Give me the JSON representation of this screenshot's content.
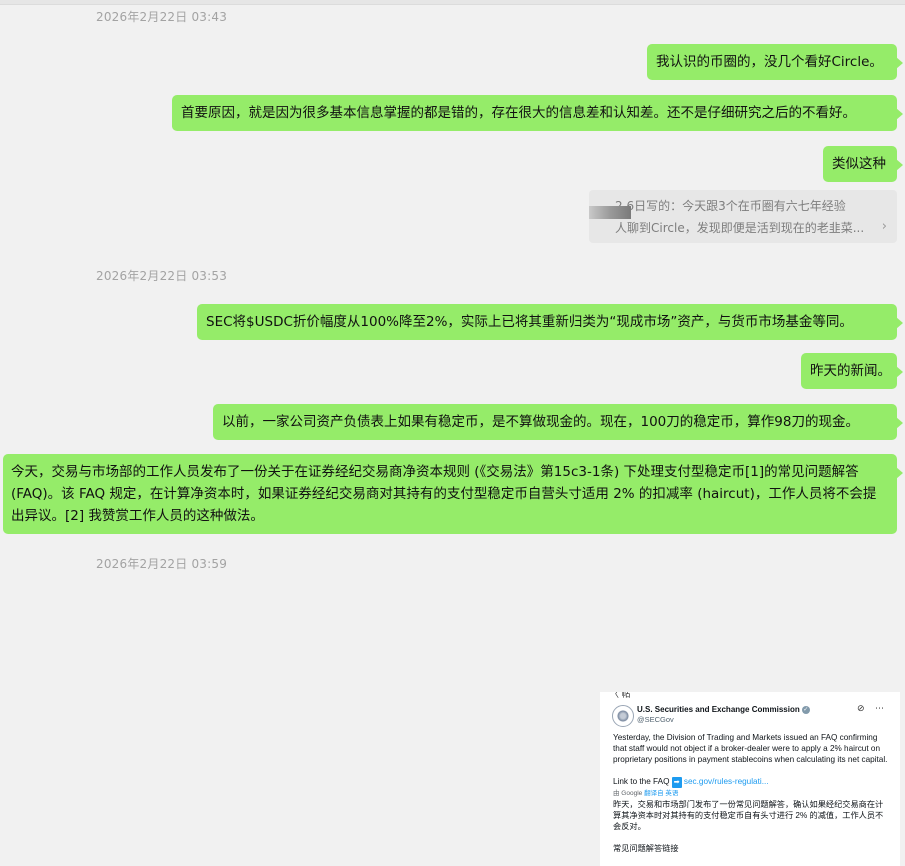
{
  "timestamps": [
    "2026年2月22日 03:43",
    "2026年2月22日 03:53",
    "2026年2月22日 03:59"
  ],
  "messages": {
    "m1": "我认识的币圈的，没几个看好Circle。",
    "m2": "首要原因，就是因为很多基本信息掌握的都是错的，存在很大的信息差和认知差。还不是仔细研究之后的不看好。",
    "m3": "类似这种",
    "m4": "SEC将$USDC折价幅度从100%降至2%，实际上已将其重新归类为“现成市场”资产，与货币市场基金等同。",
    "m5": "昨天的新闻。",
    "m6": "以前，一家公司资产负债表上如果有稳定币，是不算做现金的。现在，100刀的稳定币，算作98刀的现金。",
    "m7": "今天，交易与市场部的工作人员发布了一份关于在证券经纪交易商净资本规则 (《交易法》第15c3-1条) 下处理支付型稳定币[1]的常见问题解答 (FAQ)。该 FAQ 规定，在计算净资本时，如果证券经纪交易商对其持有的支付型稳定币自营头寸适用 2% 的扣减率 (haircut)，工作人员将不会提出异议。[2] 我赞赏工作人员的这种做法。"
  },
  "quote": {
    "line1": "2.6日写的：今天跟3个在币圈有六七年经验",
    "line2": "人聊到Circle，发现即便是活到现在的老韭菜...",
    "chevron": "›"
  },
  "screenshot": {
    "cut_text": "〈 帖",
    "account_name": "U.S. Securities and Exchange Commission",
    "handle": "@SECGov",
    "icons": "⊘ ⋯",
    "post_text": "Yesterday, the Division of Trading and Markets issued an FAQ confirming that staff would not object if a broker-dealer were to apply a 2% haircut on proprietary positions in payment stablecoins when calculating its net capital.",
    "link_label": "Link to the FAQ",
    "link_arrow": "➡",
    "link_url": "sec.gov/rules-regulati...",
    "translate_by": "由 Google",
    "translate_label": "翻译自 英语",
    "translation": "昨天，交易和市场部门发布了一份常见问题解答，确认如果经纪交易商在计算其净资本时对其持有的支付稳定币自有头寸进行 2% 的减值，工作人员不会反对。",
    "more_text": "常见问题解答链接"
  },
  "colors": {
    "bubble": "#95ec69",
    "background": "#f1f1f1",
    "timestamp": "#a3a3a3"
  }
}
